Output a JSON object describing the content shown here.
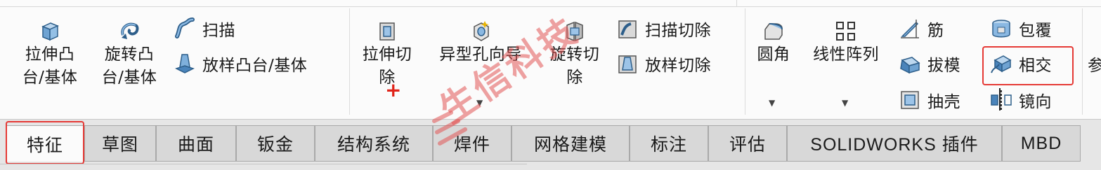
{
  "ribbon": {
    "extrude_boss": "拉伸凸\n台/基体",
    "revolve_boss": "旋转凸\n台/基体",
    "sweep": "扫描",
    "loft_boss": "放样凸台/基体",
    "extrude_cut": "拉伸切\n除",
    "hole_wizard": "异型孔向导",
    "revolve_cut": "旋转切\n除",
    "sweep_cut": "扫描切除",
    "loft_cut": "放样切除",
    "fillet": "圆角",
    "linear_pattern": "线性阵列",
    "rib": "筋",
    "draft": "拔模",
    "shell": "抽壳",
    "wrap": "包覆",
    "intersect": "相交",
    "mirror": "镜向",
    "cut_off_next": "参"
  },
  "tabs": [
    "特征",
    "草图",
    "曲面",
    "钣金",
    "结构系统",
    "焊件",
    "网格建模",
    "标注",
    "评估",
    "SOLIDWORKS 插件",
    "MBD"
  ],
  "watermark": "生信科技",
  "colors": {
    "highlight": "#e53935",
    "watermark": "#e05555"
  }
}
